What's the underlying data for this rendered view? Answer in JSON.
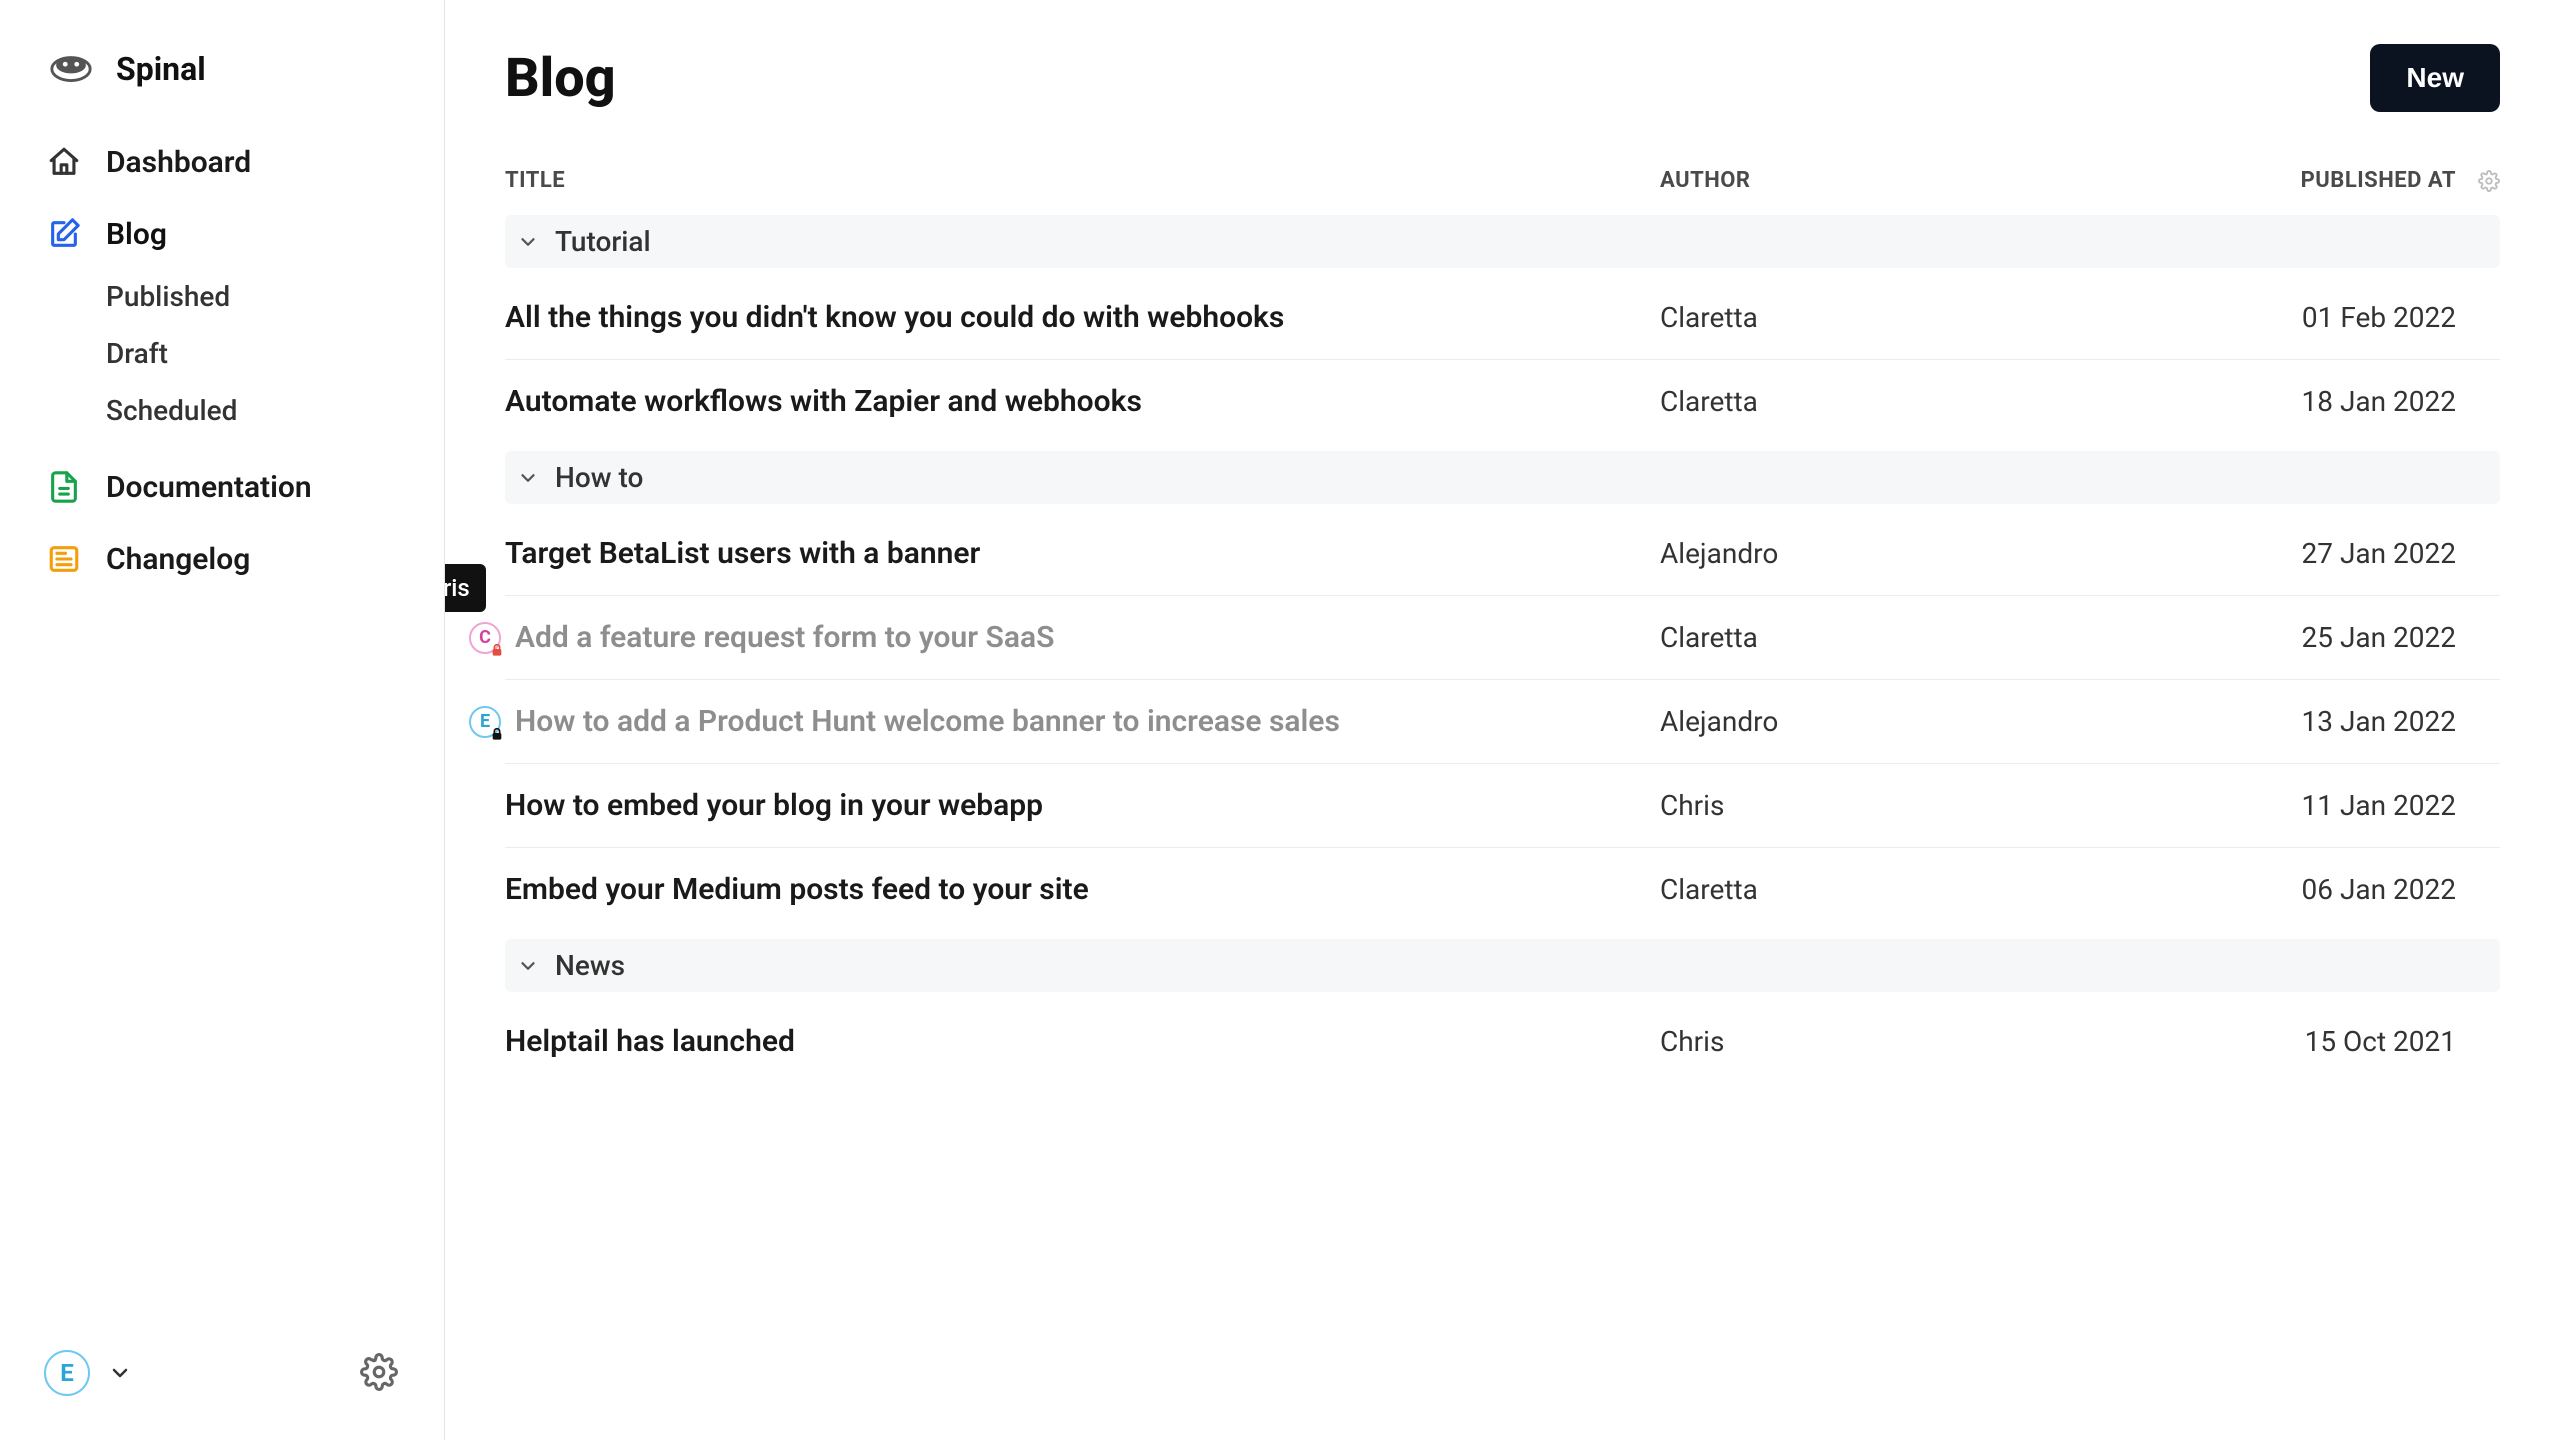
{
  "brand": {
    "name": "Spinal"
  },
  "nav": {
    "dashboard": "Dashboard",
    "blog": "Blog",
    "blog_children": {
      "published": "Published",
      "draft": "Draft",
      "scheduled": "Scheduled"
    },
    "documentation": "Documentation",
    "changelog": "Changelog"
  },
  "user": {
    "initial": "E"
  },
  "page": {
    "title": "Blog",
    "new_button": "New"
  },
  "table": {
    "headers": {
      "title": "TITLE",
      "author": "AUTHOR",
      "published": "PUBLISHED AT"
    }
  },
  "tooltip": "Locked by Chris",
  "groups": [
    {
      "name": "Tutorial",
      "rows": [
        {
          "title": "All the things you didn't know you could do with webhooks",
          "author": "Claretta",
          "date": "01 Feb 2022"
        },
        {
          "title": "Automate workflows with Zapier and webhooks",
          "author": "Claretta",
          "date": "18 Jan 2022"
        }
      ]
    },
    {
      "name": "How to",
      "rows": [
        {
          "title": "Target BetaList users with a banner",
          "author": "Alejandro",
          "date": "27 Jan 2022"
        },
        {
          "title": "Add a feature request form to your SaaS",
          "author": "Claretta",
          "date": "25 Jan 2022",
          "locked": true,
          "badge": "C",
          "badgeColor": "pink",
          "lockColor": "#e24f3d",
          "tooltip": true
        },
        {
          "title": "How to add a Product Hunt welcome banner to increase sales",
          "author": "Alejandro",
          "date": "13 Jan 2022",
          "locked": true,
          "badge": "E",
          "badgeColor": "blue",
          "lockColor": "#111"
        },
        {
          "title": "How to embed your blog in your webapp",
          "author": "Chris",
          "date": "11 Jan 2022"
        },
        {
          "title": "Embed your Medium posts feed to your site",
          "author": "Claretta",
          "date": "06 Jan 2022"
        }
      ]
    },
    {
      "name": "News",
      "rows": [
        {
          "title": "Helptail has launched",
          "author": "Chris",
          "date": "15 Oct 2021"
        }
      ]
    }
  ]
}
